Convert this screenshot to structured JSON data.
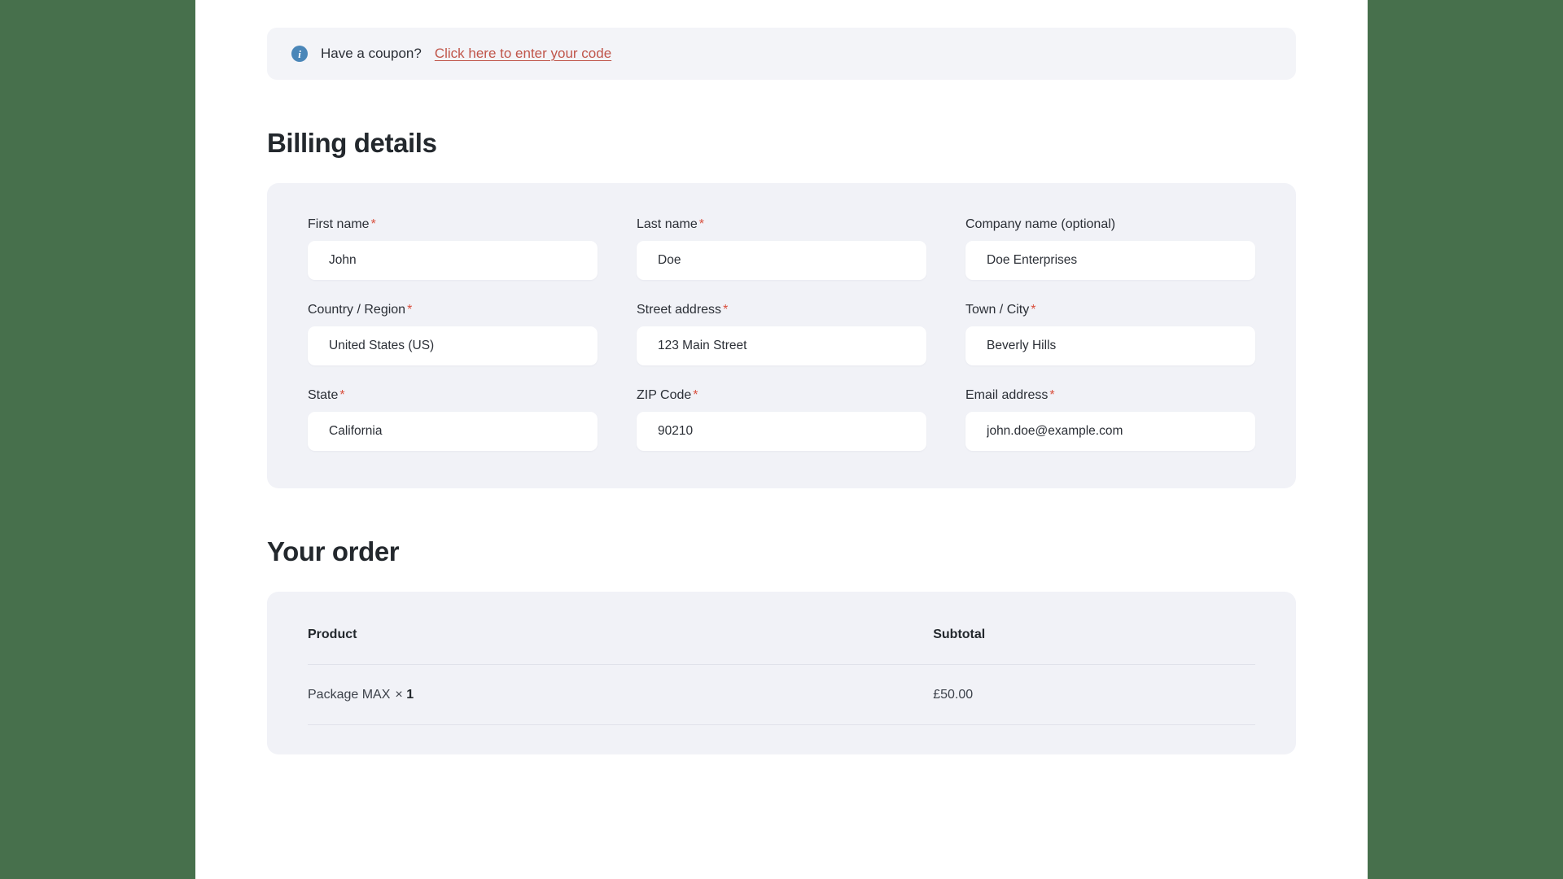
{
  "coupon_notice": {
    "icon": "info-icon",
    "text": "Have a coupon?",
    "link_label": "Click here to enter your code",
    "link_color": "#c0564a",
    "icon_color": "#4a86b8"
  },
  "billing": {
    "heading": "Billing details",
    "required_marker": "*",
    "fields": [
      {
        "label": "First name",
        "required": true,
        "value": "John",
        "type": "text"
      },
      {
        "label": "Last name",
        "required": true,
        "value": "Doe",
        "type": "text"
      },
      {
        "label": "Company name (optional)",
        "required": false,
        "value": "Doe Enterprises",
        "type": "text"
      },
      {
        "label": "Country / Region",
        "required": true,
        "value": "United States (US)",
        "type": "select"
      },
      {
        "label": "Street address",
        "required": true,
        "value": "123 Main Street",
        "type": "text"
      },
      {
        "label": "Town / City",
        "required": true,
        "value": "Beverly Hills",
        "type": "text"
      },
      {
        "label": "State",
        "required": true,
        "value": "California",
        "type": "select"
      },
      {
        "label": "ZIP Code",
        "required": true,
        "value": "90210",
        "type": "text"
      },
      {
        "label": "Email address",
        "required": true,
        "value": "john.doe@example.com",
        "type": "email"
      }
    ]
  },
  "order": {
    "heading": "Your order",
    "columns": {
      "product": "Product",
      "subtotal": "Subtotal"
    },
    "items": [
      {
        "name": "Package MAX",
        "quantity_symbol": "×",
        "quantity": "1",
        "subtotal": "£50.00"
      }
    ]
  },
  "theme": {
    "page_background": "#47704c",
    "content_background": "#ffffff",
    "panel_background": "#f1f2f7",
    "notice_background": "#f3f4f8",
    "heading_color": "#23282d",
    "accent_link": "#c0564a",
    "required_color": "#d94f3d"
  }
}
